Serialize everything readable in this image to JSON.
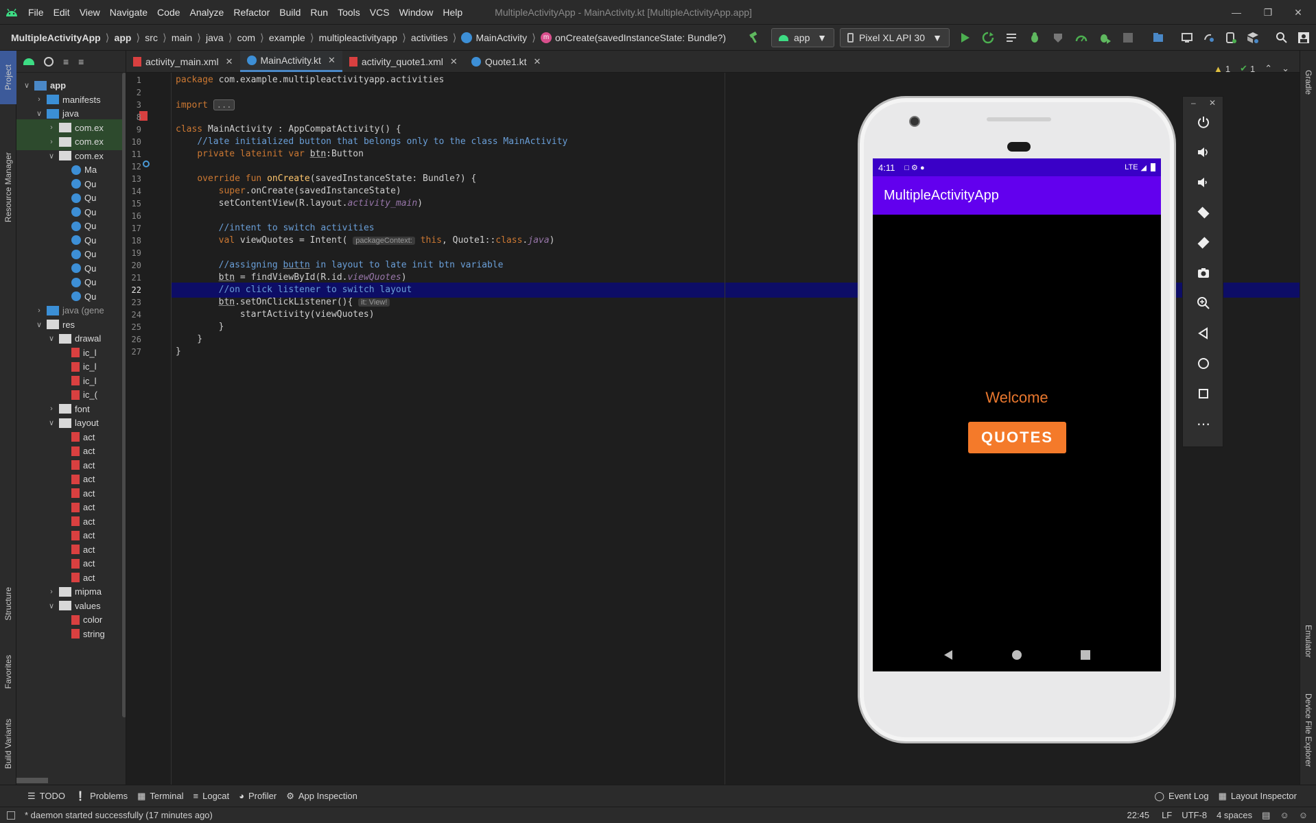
{
  "menubar": {
    "items": [
      "File",
      "Edit",
      "View",
      "Navigate",
      "Code",
      "Analyze",
      "Refactor",
      "Build",
      "Run",
      "Tools",
      "VCS",
      "Window",
      "Help"
    ],
    "window_title": "MultipleActivityApp - MainActivity.kt [MultipleActivityApp.app]"
  },
  "breadcrumb": {
    "items": [
      "MultipleActivityApp",
      "app",
      "src",
      "main",
      "java",
      "com",
      "example",
      "multipleactivityapp",
      "activities",
      "MainActivity",
      "onCreate(savedInstanceState: Bundle?)"
    ]
  },
  "toolbar": {
    "run_config": "app",
    "device": "Pixel XL API 30"
  },
  "left_tool_tabs": [
    "Project",
    "Resource Manager",
    "Structure",
    "Favorites",
    "Build Variants"
  ],
  "right_tool_tabs": [
    "Gradle",
    "Emulator",
    "Device File Explorer"
  ],
  "tree": [
    {
      "label": "app",
      "level": 0,
      "arrow": "v",
      "icon": "module"
    },
    {
      "label": "manifests",
      "level": 1,
      "arrow": ">",
      "icon": "folder-blue"
    },
    {
      "label": "java",
      "level": 1,
      "arrow": "v",
      "icon": "folder-blue"
    },
    {
      "label": "com.ex",
      "level": 2,
      "arrow": ">",
      "icon": "package",
      "sel": true
    },
    {
      "label": "com.ex",
      "level": 2,
      "arrow": ">",
      "icon": "package",
      "sel": true
    },
    {
      "label": "com.ex",
      "level": 2,
      "arrow": "v",
      "icon": "package"
    },
    {
      "label": "Ma",
      "level": 3,
      "arrow": "",
      "icon": "kotlin"
    },
    {
      "label": "Qu",
      "level": 3,
      "arrow": "",
      "icon": "kotlin"
    },
    {
      "label": "Qu",
      "level": 3,
      "arrow": "",
      "icon": "kotlin"
    },
    {
      "label": "Qu",
      "level": 3,
      "arrow": "",
      "icon": "kotlin"
    },
    {
      "label": "Qu",
      "level": 3,
      "arrow": "",
      "icon": "kotlin"
    },
    {
      "label": "Qu",
      "level": 3,
      "arrow": "",
      "icon": "kotlin"
    },
    {
      "label": "Qu",
      "level": 3,
      "arrow": "",
      "icon": "kotlin"
    },
    {
      "label": "Qu",
      "level": 3,
      "arrow": "",
      "icon": "kotlin"
    },
    {
      "label": "Qu",
      "level": 3,
      "arrow": "",
      "icon": "kotlin"
    },
    {
      "label": "Qu",
      "level": 3,
      "arrow": "",
      "icon": "kotlin"
    },
    {
      "label": "java (gene",
      "level": 1,
      "arrow": ">",
      "icon": "folder-gen"
    },
    {
      "label": "res",
      "level": 1,
      "arrow": "v",
      "icon": "folder-res"
    },
    {
      "label": "drawal",
      "level": 2,
      "arrow": "v",
      "icon": "folder"
    },
    {
      "label": "ic_l",
      "level": 3,
      "arrow": "",
      "icon": "xml"
    },
    {
      "label": "ic_l",
      "level": 3,
      "arrow": "",
      "icon": "xml"
    },
    {
      "label": "ic_l",
      "level": 3,
      "arrow": "",
      "icon": "xml"
    },
    {
      "label": "ic_(",
      "level": 3,
      "arrow": "",
      "icon": "xml"
    },
    {
      "label": "font",
      "level": 2,
      "arrow": ">",
      "icon": "folder"
    },
    {
      "label": "layout",
      "level": 2,
      "arrow": "v",
      "icon": "folder"
    },
    {
      "label": "act",
      "level": 3,
      "arrow": "",
      "icon": "xml"
    },
    {
      "label": "act",
      "level": 3,
      "arrow": "",
      "icon": "xml"
    },
    {
      "label": "act",
      "level": 3,
      "arrow": "",
      "icon": "xml"
    },
    {
      "label": "act",
      "level": 3,
      "arrow": "",
      "icon": "xml"
    },
    {
      "label": "act",
      "level": 3,
      "arrow": "",
      "icon": "xml"
    },
    {
      "label": "act",
      "level": 3,
      "arrow": "",
      "icon": "xml"
    },
    {
      "label": "act",
      "level": 3,
      "arrow": "",
      "icon": "xml"
    },
    {
      "label": "act",
      "level": 3,
      "arrow": "",
      "icon": "xml"
    },
    {
      "label": "act",
      "level": 3,
      "arrow": "",
      "icon": "xml"
    },
    {
      "label": "act",
      "level": 3,
      "arrow": "",
      "icon": "xml"
    },
    {
      "label": "act",
      "level": 3,
      "arrow": "",
      "icon": "xml"
    },
    {
      "label": "mipma",
      "level": 2,
      "arrow": ">",
      "icon": "folder"
    },
    {
      "label": "values",
      "level": 2,
      "arrow": "v",
      "icon": "folder"
    },
    {
      "label": "color",
      "level": 3,
      "arrow": "",
      "icon": "xml"
    },
    {
      "label": "string",
      "level": 3,
      "arrow": "",
      "icon": "xml"
    }
  ],
  "tabs": [
    {
      "label": "activity_main.xml",
      "icon": "xml",
      "active": false
    },
    {
      "label": "MainActivity.kt",
      "icon": "kotlin",
      "active": true
    },
    {
      "label": "activity_quote1.xml",
      "icon": "xml",
      "active": false
    },
    {
      "label": "Quote1.kt",
      "icon": "kotlin",
      "active": false
    }
  ],
  "inspection": {
    "warnings": "1",
    "ok": "1"
  },
  "editor": {
    "current_line": "22",
    "lines": [
      {
        "n": "1",
        "html": "<span class=\"kw\">package</span> com.example.multipleactivityapp.activities"
      },
      {
        "n": "2",
        "html": ""
      },
      {
        "n": "3",
        "html": "<span class=\"kw\">import</span> <span class=\"hint\" style=\"font-family:'DejaVu Sans Mono',monospace;font-size:12px;border:1px solid #666;\">...</span>"
      },
      {
        "n": "8",
        "html": ""
      },
      {
        "n": "9",
        "html": "<span class=\"kw\">class</span> MainActivity : AppCompatActivity() {"
      },
      {
        "n": "10",
        "html": "    <span class=\"cmt\">//late initialized button that belongs only to the class MainActivity</span>"
      },
      {
        "n": "11",
        "html": "    <span class=\"kw\">private lateinit var</span> <span class=\"ul\">btn</span>:Button"
      },
      {
        "n": "12",
        "html": ""
      },
      {
        "n": "13",
        "html": "    <span class=\"kw\">override fun</span> <span class=\"fn\">onCreate</span>(savedInstanceState: Bundle?) {"
      },
      {
        "n": "14",
        "html": "        <span class=\"kw\">super</span>.onCreate(savedInstanceState)"
      },
      {
        "n": "15",
        "html": "        setContentView(R.layout.<span class=\"it\">activity_main</span>)"
      },
      {
        "n": "16",
        "html": ""
      },
      {
        "n": "17",
        "html": "        <span class=\"cmt\">//intent to switch activities</span>"
      },
      {
        "n": "18",
        "html": "        <span class=\"kw\">val</span> viewQuotes = Intent( <span class=\"hint\">packageContext:</span> <span class=\"kw\">this</span>, Quote1::<span class=\"kw\">class</span>.<span class=\"it\">java</span>)"
      },
      {
        "n": "19",
        "html": ""
      },
      {
        "n": "20",
        "html": "        <span class=\"cmt\">//assigning <span class=\"ul\">buttn</span> in layout to late init btn variable</span>"
      },
      {
        "n": "21",
        "html": "        <span class=\"ul\">btn</span> = findViewById(R.id.<span class=\"it\">viewQuotes</span>)"
      },
      {
        "n": "22",
        "html": "        <span class=\"cmt\">//on click listener to switch layout</span>"
      },
      {
        "n": "23",
        "html": "        <span class=\"ul\">btn</span>.setOnClickListener(){ <span class=\"hint\">it: View!</span>"
      },
      {
        "n": "24",
        "html": "            startActivity(viewQuotes)"
      },
      {
        "n": "25",
        "html": "        }"
      },
      {
        "n": "26",
        "html": "    }"
      },
      {
        "n": "27",
        "html": "}"
      }
    ]
  },
  "emulator": {
    "time": "4:11",
    "network": "LTE",
    "app_title": "MultipleActivityApp",
    "welcome": "Welcome",
    "quotes_button": "QUOTES"
  },
  "bottom_tools": [
    "TODO",
    "Problems",
    "Terminal",
    "Logcat",
    "Profiler",
    "App Inspection"
  ],
  "bottom_right_tools": [
    "Event Log",
    "Layout Inspector"
  ],
  "status": {
    "message": "* daemon started successfully (17 minutes ago)",
    "position": "22:45",
    "line_sep": "LF",
    "encoding": "UTF-8",
    "indent": "4 spaces"
  },
  "colors": {
    "accent": "#6200ee",
    "status_bar": "#3a00c7",
    "button": "#f47a2a",
    "welcome": "#e8772e",
    "current_line": "#0d0d66"
  }
}
